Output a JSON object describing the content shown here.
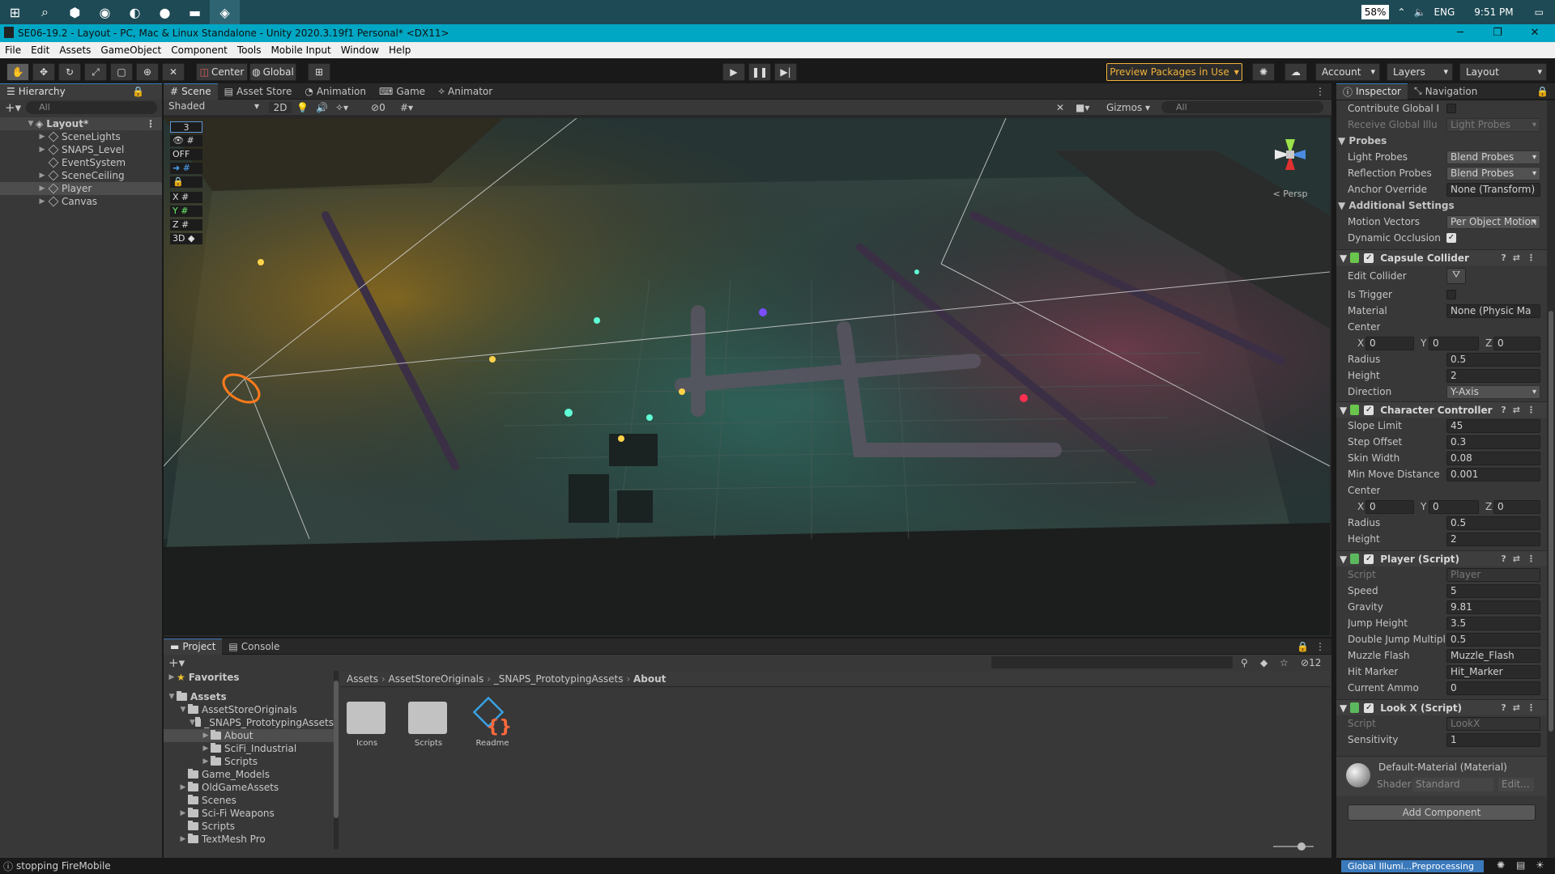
{
  "taskbar": {
    "battery": "58%",
    "lang": "ENG",
    "time": "9:51 PM"
  },
  "title": "SE06-19.2 - Layout - PC, Mac & Linux Standalone - Unity 2020.3.19f1 Personal* <DX11>",
  "menu": [
    "File",
    "Edit",
    "Assets",
    "GameObject",
    "Component",
    "Tools",
    "Mobile Input",
    "Window",
    "Help"
  ],
  "toolbar": {
    "center": "Center",
    "global": "Global",
    "preview": "Preview Packages in Use",
    "account": "Account",
    "layers": "Layers",
    "layout": "Layout"
  },
  "hierarchy": {
    "title": "Hierarchy",
    "search_placeholder": "All",
    "root": "Layout*",
    "items": [
      "SceneLights",
      "SNAPS_Level",
      "EventSystem",
      "SceneCeiling",
      "Player",
      "Canvas"
    ]
  },
  "scene": {
    "tabs": [
      "Scene",
      "Asset Store",
      "Animation",
      "Game",
      "Animator"
    ],
    "shading": "Shaded",
    "mode2d": "2D",
    "hidden_count": "0",
    "gizmos": "Gizmos",
    "search_placeholder": "All",
    "overlay": [
      "3",
      "OFF",
      "X",
      "Y",
      "Z",
      "3D"
    ],
    "persp": "< Persp"
  },
  "project": {
    "tabs": [
      "Project",
      "Console"
    ],
    "favorites": "Favorites",
    "count": "12",
    "tree": [
      {
        "label": "Assets",
        "depth": 0,
        "bold": true
      },
      {
        "label": "AssetStoreOriginals",
        "depth": 1
      },
      {
        "label": "_SNAPS_PrototypingAssets",
        "depth": 2
      },
      {
        "label": "About",
        "depth": 3,
        "sel": true
      },
      {
        "label": "SciFi_Industrial",
        "depth": 3
      },
      {
        "label": "Scripts",
        "depth": 3
      },
      {
        "label": "Game_Models",
        "depth": 1
      },
      {
        "label": "OldGameAssets",
        "depth": 1
      },
      {
        "label": "Scenes",
        "depth": 1
      },
      {
        "label": "Sci-Fi Weapons",
        "depth": 1
      },
      {
        "label": "Scripts",
        "depth": 1
      },
      {
        "label": "TextMesh Pro",
        "depth": 1
      }
    ],
    "breadcrumb": [
      "Assets",
      "AssetStoreOriginals",
      "_SNAPS_PrototypingAssets",
      "About"
    ],
    "files": [
      "Icons",
      "Scripts",
      "Readme"
    ]
  },
  "inspector": {
    "tabs": [
      "Inspector",
      "Navigation"
    ],
    "rows1": [
      {
        "label": "Contribute Global I",
        "type": "check"
      },
      {
        "label": "Receive Global Illu",
        "value": "Light Probes",
        "type": "popdim"
      }
    ],
    "probes_title": "Probes",
    "probes": [
      {
        "label": "Light Probes",
        "value": "Blend Probes"
      },
      {
        "label": "Reflection Probes",
        "value": "Blend Probes"
      },
      {
        "label": "Anchor Override",
        "value": "None (Transform)"
      }
    ],
    "additional_title": "Additional Settings",
    "additional": [
      {
        "label": "Motion Vectors",
        "value": "Per Object Motion"
      },
      {
        "label": "Dynamic Occlusion",
        "value": "✓"
      }
    ],
    "capsule": {
      "title": "Capsule Collider",
      "edit": "Edit Collider",
      "is_trigger": "Is Trigger",
      "material_label": "Material",
      "material": "None (Physic Ma",
      "center": "Center",
      "cx": "0",
      "cy": "0",
      "cz": "0",
      "radius_label": "Radius",
      "radius": "0.5",
      "height_label": "Height",
      "height": "2",
      "direction_label": "Direction",
      "direction": "Y-Axis"
    },
    "controller": {
      "title": "Character Controller",
      "rows": [
        {
          "label": "Slope Limit",
          "value": "45"
        },
        {
          "label": "Step Offset",
          "value": "0.3"
        },
        {
          "label": "Skin Width",
          "value": "0.08"
        },
        {
          "label": "Min Move Distance",
          "value": "0.001"
        }
      ],
      "center": "Center",
      "cx": "0",
      "cy": "0",
      "cz": "0",
      "radius_label": "Radius",
      "radius": "0.5",
      "height_label": "Height",
      "height": "2"
    },
    "player": {
      "title": "Player (Script)",
      "script_label": "Script",
      "script": "Player",
      "rows": [
        {
          "label": "Speed",
          "value": "5"
        },
        {
          "label": "Gravity",
          "value": "9.81"
        },
        {
          "label": "Jump Height",
          "value": "3.5"
        },
        {
          "label": "Double Jump Multipli",
          "value": "0.5"
        },
        {
          "label": "Muzzle Flash",
          "value": "Muzzle_Flash"
        },
        {
          "label": "Hit Marker",
          "value": "Hit_Marker"
        },
        {
          "label": "Current Ammo",
          "value": "0"
        }
      ]
    },
    "lookx": {
      "title": "Look X (Script)",
      "script_label": "Script",
      "script": "LookX",
      "sens_label": "Sensitivity",
      "sens": "1"
    },
    "material": {
      "name": "Default-Material (Material)",
      "shader_label": "Shader",
      "shader": "Standard",
      "edit": "Edit..."
    },
    "add_component": "Add Component"
  },
  "status": {
    "message": "stopping FireMobile",
    "progress": "Global Illumi...Preprocessing"
  }
}
